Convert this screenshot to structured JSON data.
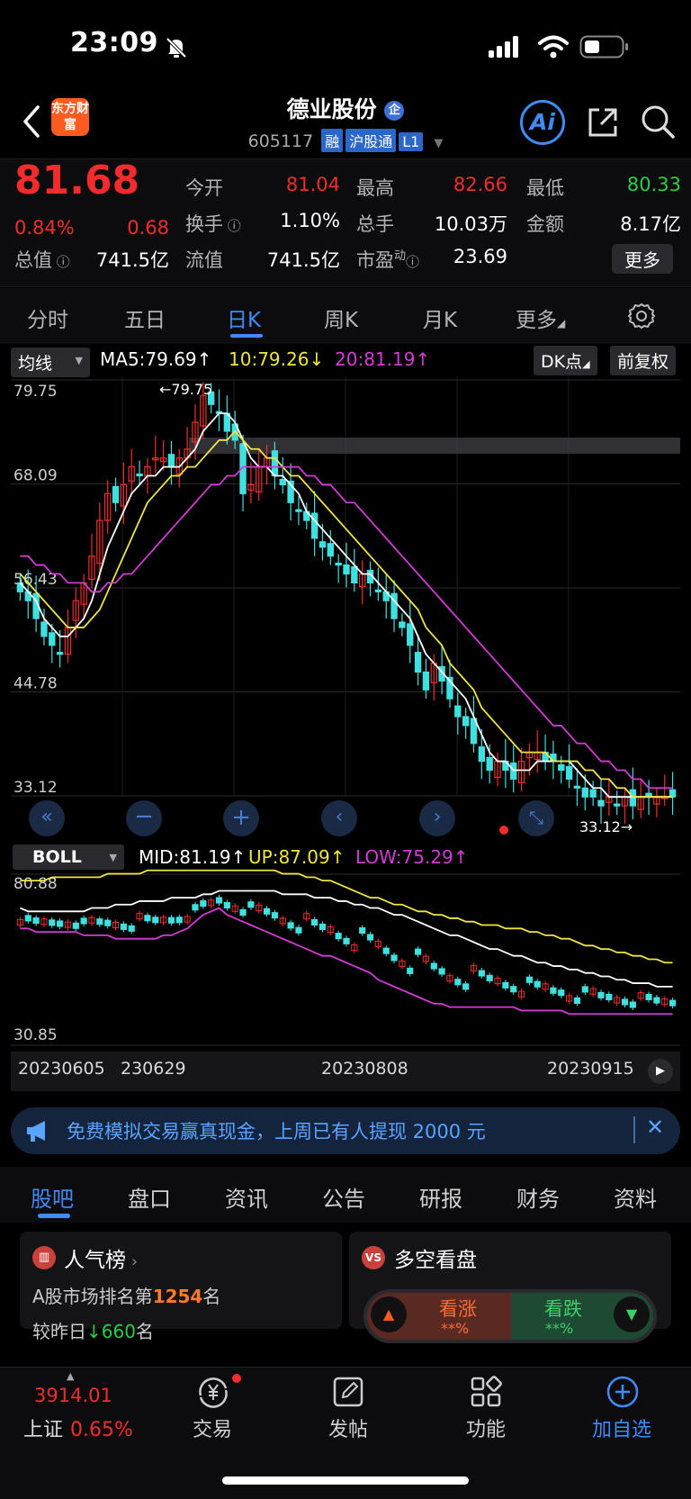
{
  "status_bar": {
    "time": "23:09"
  },
  "header": {
    "logo": "东方财富",
    "stock_name": "德业股份",
    "name_badge": "企",
    "code": "605117",
    "tags": [
      "融",
      "沪股通",
      "L1"
    ],
    "ai_label": "Ai"
  },
  "quote": {
    "price": "81.68",
    "change_pct": "0.84%",
    "change_amt": "0.68",
    "open_label": "今开",
    "open": "81.04",
    "high_label": "最高",
    "high": "82.66",
    "low_label": "最低",
    "low": "80.33",
    "turnover_label": "换手",
    "turnover": "1.10%",
    "volume_label": "总手",
    "volume": "10.03万",
    "amount_label": "金额",
    "amount": "8.17亿",
    "mktcap_label": "总值",
    "mktcap": "741.5亿",
    "float_label": "流值",
    "float_cap": "741.5亿",
    "pe_label": "市盈",
    "pe_sup": "动",
    "pe": "23.69",
    "more_label": "更多"
  },
  "period_tabs": [
    {
      "label": "分时",
      "active": false
    },
    {
      "label": "五日",
      "active": false
    },
    {
      "label": "日K",
      "active": true
    },
    {
      "label": "周K",
      "active": false
    },
    {
      "label": "月K",
      "active": false
    },
    {
      "label": "更多",
      "active": false
    }
  ],
  "ma_row": {
    "selector": "均线",
    "ma5": "MA5:79.69↑",
    "ma10": "10:79.26↓",
    "ma20": "20:81.19↑",
    "dk_label": "DK点",
    "adjust_label": "前复权"
  },
  "colors": {
    "up": "#f22c2c",
    "down": "#3fe0e0",
    "ma5": "#ffffff",
    "ma10": "#f0e441",
    "ma20": "#d43ad6",
    "accent": "#3e8cf7"
  },
  "boll_row": {
    "selector": "BOLL",
    "mid": "MID:81.19↑",
    "up": "UP:87.09↑",
    "low": "LOW:75.29↑"
  },
  "chart_data": [
    {
      "type": "candlestick",
      "y_ticks": [
        "79.75",
        "68.09",
        "56.43",
        "44.78",
        "33.12"
      ],
      "ylim": [
        33.12,
        79.75
      ],
      "max_marker": "79.75",
      "min_marker": "33.12",
      "closes": [
        56,
        55,
        53,
        51,
        50,
        49,
        52,
        55,
        57,
        60,
        64,
        67,
        66,
        68,
        70,
        69,
        70,
        71,
        71,
        70,
        71,
        72,
        75,
        78,
        77,
        76,
        74,
        73,
        67,
        68,
        70,
        71,
        69,
        68,
        66,
        65,
        64,
        62,
        61,
        60,
        59,
        58,
        57,
        58,
        57,
        56,
        55,
        53,
        52,
        50,
        47,
        45,
        48,
        46,
        44,
        42,
        41,
        39,
        37,
        36,
        37,
        36,
        35,
        37,
        38,
        38,
        37,
        37,
        36,
        35,
        34,
        33,
        33,
        32,
        33,
        32,
        33,
        32,
        33,
        33,
        33,
        33,
        33
      ],
      "series": [
        {
          "name": "MA5",
          "values": [
            57,
            56,
            55,
            53,
            52,
            51,
            51,
            52,
            53,
            55,
            58,
            61,
            63,
            65,
            67,
            68,
            69,
            69,
            70,
            70,
            70,
            71,
            72,
            74,
            75,
            76,
            76,
            75,
            73,
            71,
            70,
            70,
            69,
            69,
            68,
            67,
            65,
            64,
            63,
            62,
            61,
            60,
            59,
            58,
            58,
            57,
            56,
            55,
            54,
            53,
            51,
            49,
            48,
            47,
            46,
            45,
            44,
            42,
            40,
            38,
            37,
            37,
            36,
            36,
            36,
            37,
            37,
            37,
            37,
            37,
            36,
            35,
            34,
            34,
            33,
            33,
            33,
            33,
            33,
            33,
            33,
            33,
            33
          ]
        },
        {
          "name": "MA10",
          "values": [
            58,
            57,
            56,
            55,
            54,
            53,
            52,
            52,
            52,
            53,
            54,
            56,
            58,
            60,
            62,
            64,
            66,
            67,
            68,
            69,
            69,
            70,
            70,
            71,
            72,
            73,
            73,
            74,
            73,
            72,
            72,
            71,
            71,
            70,
            69,
            69,
            68,
            67,
            66,
            65,
            64,
            63,
            62,
            61,
            60,
            59,
            58,
            57,
            56,
            55,
            54,
            52,
            51,
            50,
            48,
            47,
            46,
            45,
            43,
            42,
            41,
            40,
            39,
            38,
            38,
            38,
            38,
            37,
            37,
            37,
            37,
            36,
            36,
            35,
            35,
            34,
            34,
            33,
            33,
            33,
            33,
            33,
            33
          ]
        },
        {
          "name": "MA20",
          "values": [
            60,
            60,
            59,
            59,
            58,
            58,
            57,
            57,
            57,
            56,
            56,
            57,
            57,
            58,
            58,
            59,
            60,
            61,
            62,
            63,
            64,
            65,
            66,
            67,
            68,
            68,
            69,
            69,
            70,
            70,
            70,
            70,
            70,
            70,
            70,
            70,
            69,
            69,
            68,
            68,
            67,
            66,
            66,
            65,
            64,
            63,
            62,
            61,
            60,
            59,
            58,
            57,
            56,
            55,
            54,
            53,
            52,
            51,
            50,
            49,
            48,
            47,
            46,
            45,
            44,
            43,
            42,
            41,
            41,
            40,
            39,
            39,
            38,
            37,
            37,
            36,
            36,
            35,
            35,
            34,
            34,
            34,
            34
          ]
        }
      ]
    },
    {
      "type": "boll",
      "y_ticks": [
        "80.88",
        "30.85"
      ],
      "ylim": [
        30.85,
        80.88
      ],
      "x_ticks": [
        "20230605",
        "230629",
        "20230808",
        "20230915"
      ],
      "series": [
        {
          "name": "MID",
          "values": [
            71,
            70,
            70,
            70,
            70,
            70,
            70,
            70,
            70,
            71,
            71,
            71,
            72,
            72,
            72,
            73,
            73,
            73,
            73,
            74,
            74,
            74,
            74,
            75,
            75,
            76,
            76,
            76,
            76,
            76,
            76,
            76,
            76,
            75,
            75,
            75,
            75,
            74,
            74,
            74,
            73,
            73,
            72,
            72,
            71,
            71,
            70,
            69,
            69,
            68,
            67,
            66,
            65,
            64,
            63,
            63,
            62,
            61,
            60,
            59,
            59,
            58,
            57,
            57,
            56,
            55,
            55,
            54,
            54,
            53,
            53,
            52,
            52,
            51,
            51,
            50,
            50,
            49,
            49,
            49,
            48,
            48,
            48
          ]
        },
        {
          "name": "UP",
          "values": [
            79,
            79,
            79,
            79,
            80,
            80,
            80,
            80,
            80,
            80,
            80,
            81,
            81,
            81,
            81,
            81,
            82,
            82,
            82,
            82,
            82,
            82,
            82,
            82,
            82,
            82,
            82,
            82,
            82,
            82,
            82,
            82,
            82,
            81,
            81,
            81,
            80,
            80,
            79,
            79,
            78,
            77,
            76,
            75,
            74,
            74,
            73,
            72,
            72,
            71,
            70,
            70,
            69,
            69,
            68,
            68,
            67,
            67,
            66,
            66,
            66,
            65,
            65,
            65,
            64,
            64,
            63,
            63,
            62,
            62,
            61,
            60,
            60,
            59,
            59,
            58,
            58,
            57,
            57,
            56,
            56,
            55,
            55
          ]
        },
        {
          "name": "LOW",
          "values": [
            65,
            65,
            64,
            64,
            64,
            64,
            64,
            64,
            63,
            63,
            63,
            63,
            62,
            62,
            62,
            62,
            62,
            62,
            63,
            63,
            64,
            65,
            67,
            69,
            70,
            71,
            69,
            68,
            67,
            66,
            65,
            64,
            63,
            62,
            61,
            60,
            59,
            58,
            57,
            57,
            56,
            55,
            54,
            53,
            52,
            50,
            49,
            48,
            47,
            46,
            45,
            44,
            43,
            43,
            42,
            42,
            42,
            42,
            42,
            42,
            42,
            42,
            42,
            41,
            41,
            41,
            41,
            41,
            41,
            40,
            40,
            40,
            40,
            40,
            40,
            40,
            40,
            40,
            40,
            40,
            40,
            40,
            40
          ]
        }
      ]
    }
  ],
  "banner": {
    "text": "免费模拟交易赢真现金，上周已有人提现 2000 元"
  },
  "news_tabs": [
    {
      "label": "股吧",
      "active": true
    },
    {
      "label": "盘口",
      "active": false
    },
    {
      "label": "资讯",
      "active": false
    },
    {
      "label": "公告",
      "active": false
    },
    {
      "label": "研报",
      "active": false
    },
    {
      "label": "财务",
      "active": false
    },
    {
      "label": "资料",
      "active": false
    }
  ],
  "popularity": {
    "title": "人气榜",
    "rank_prefix": "A股市场排名第",
    "rank": "1254",
    "rank_suffix": "名",
    "change_prefix": "较昨日",
    "change": "660",
    "change_suffix": "名"
  },
  "sentiment": {
    "title": "多空看盘",
    "bull_label": "看涨",
    "bull_value": "**%",
    "bear_label": "看跌",
    "bear_value": "**%"
  },
  "bottom_nav": {
    "index_value": "3914.01",
    "index_name": "上证",
    "index_pct": "0.65%",
    "items": [
      "交易",
      "发帖",
      "功能",
      "加自选"
    ]
  }
}
